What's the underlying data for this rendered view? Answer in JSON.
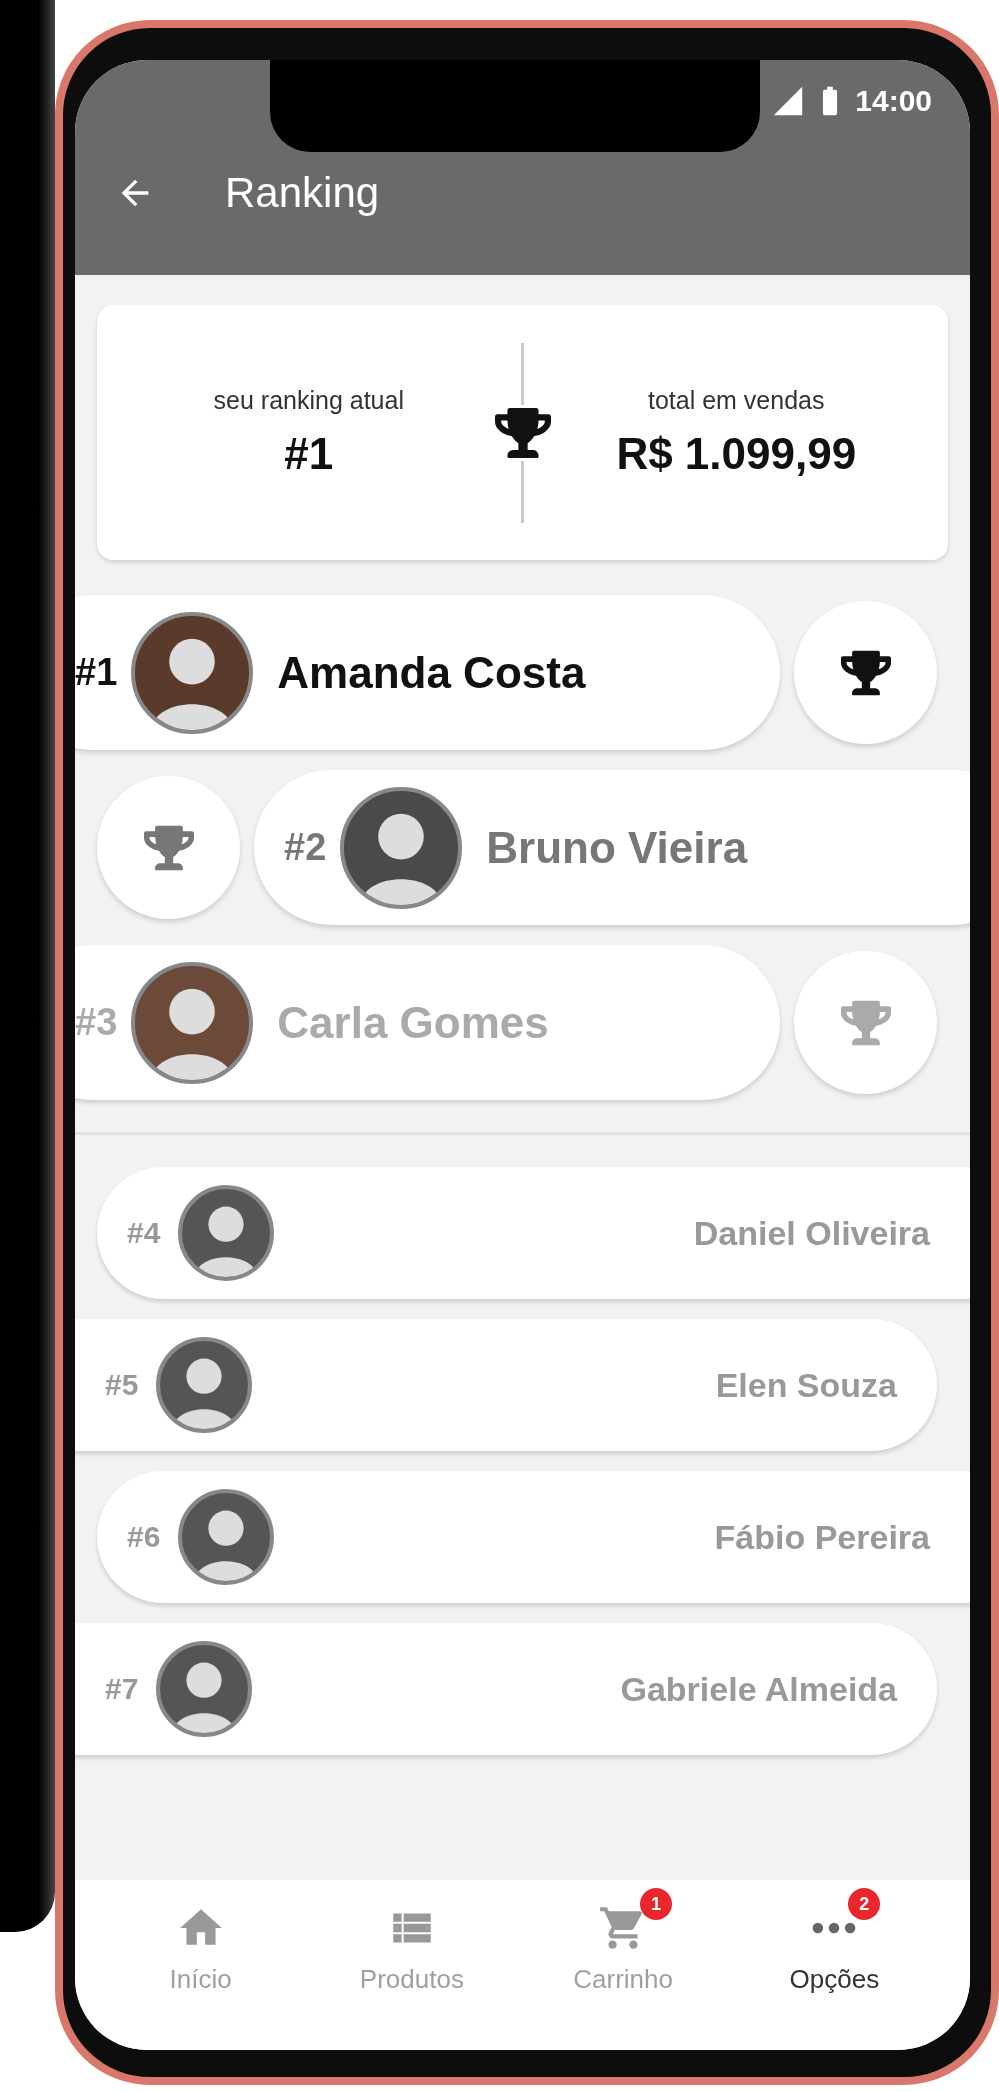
{
  "status_bar": {
    "time": "14:00"
  },
  "header": {
    "title": "Ranking"
  },
  "summary": {
    "rank_label": "seu ranking atual",
    "rank": "#1",
    "sales_label": "total em vendas",
    "sales": "R$ 1.099,99"
  },
  "podium": [
    {
      "rank": "#1",
      "name": "Amanda Costa",
      "color": "#111111"
    },
    {
      "rank": "#2",
      "name": "Bruno Vieira",
      "color": "#777777"
    },
    {
      "rank": "#3",
      "name": "Carla Gomes",
      "color": "#aaaaaa"
    }
  ],
  "ranking": [
    {
      "rank": "#4",
      "name": "Daniel Oliveira"
    },
    {
      "rank": "#5",
      "name": "Elen Souza"
    },
    {
      "rank": "#6",
      "name": "Fábio Pereira"
    },
    {
      "rank": "#7",
      "name": "Gabriele Almeida"
    }
  ],
  "bottom_nav": [
    {
      "label": "Início",
      "selected": false
    },
    {
      "label": "Produtos",
      "selected": false
    },
    {
      "label": "Carrinho",
      "badge": "1",
      "selected": false
    },
    {
      "label": "Opções",
      "badge": "2",
      "selected": true
    }
  ]
}
